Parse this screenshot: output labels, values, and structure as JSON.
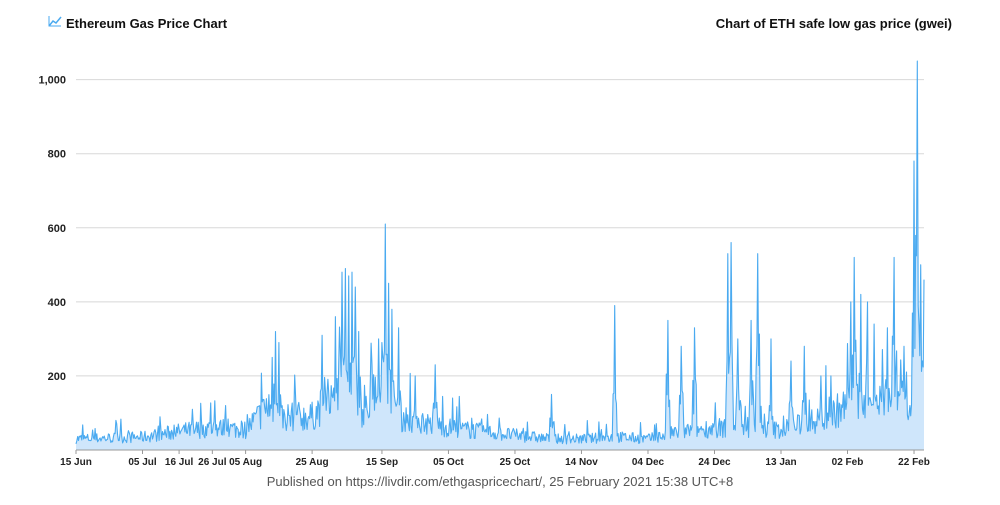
{
  "header": {
    "title": "Ethereum Gas Price Chart",
    "icon": "line-chart-icon",
    "subtitle": "Chart of ETH safe low gas price (gwei)"
  },
  "footer": {
    "text": "Published on https://livdir.com/ethgaspricechart/, 25 February 2021 15:38 UTC+8"
  },
  "colors": {
    "line": "#4aaaf0",
    "fill": "#cfe6fb",
    "grid": "#d8d8d8"
  },
  "chart_data": {
    "type": "area",
    "title": "Chart of ETH safe low gas price (gwei)",
    "xlabel": "",
    "ylabel": "",
    "x_range": [
      "2020-06-15",
      "2021-02-25"
    ],
    "ylim": [
      0,
      1080
    ],
    "y_ticks": [
      200,
      400,
      600,
      800,
      1000
    ],
    "y_tick_labels": [
      "200",
      "400",
      "600",
      "800",
      "1,000"
    ],
    "x_ticks": [
      {
        "date": "2020-06-15",
        "label": "15 Jun"
      },
      {
        "date": "2020-07-05",
        "label": "05 Jul"
      },
      {
        "date": "2020-07-16",
        "label": "16 Jul"
      },
      {
        "date": "2020-07-26",
        "label": "26 Jul"
      },
      {
        "date": "2020-08-05",
        "label": "05 Aug"
      },
      {
        "date": "2020-08-25",
        "label": "25 Aug"
      },
      {
        "date": "2020-09-15",
        "label": "15 Sep"
      },
      {
        "date": "2020-10-05",
        "label": "05 Oct"
      },
      {
        "date": "2020-10-25",
        "label": "25 Oct"
      },
      {
        "date": "2020-11-14",
        "label": "14 Nov"
      },
      {
        "date": "2020-12-04",
        "label": "04 Dec"
      },
      {
        "date": "2020-12-24",
        "label": "24 Dec"
      },
      {
        "date": "2021-01-13",
        "label": "13 Jan"
      },
      {
        "date": "2021-02-02",
        "label": "02 Feb"
      },
      {
        "date": "2021-02-22",
        "label": "22 Feb"
      }
    ],
    "grid": true,
    "series": [
      {
        "baseline": [
          [
            "2020-06-15",
            30
          ],
          [
            "2020-07-05",
            35
          ],
          [
            "2020-07-16",
            50
          ],
          [
            "2020-07-26",
            60
          ],
          [
            "2020-08-05",
            55
          ],
          [
            "2020-08-12",
            120
          ],
          [
            "2020-08-16",
            90
          ],
          [
            "2020-08-25",
            90
          ],
          [
            "2020-08-31",
            150
          ],
          [
            "2020-09-04",
            120
          ],
          [
            "2020-09-10",
            100
          ],
          [
            "2020-09-15",
            140
          ],
          [
            "2020-09-20",
            90
          ],
          [
            "2020-09-30",
            70
          ],
          [
            "2020-10-05",
            60
          ],
          [
            "2020-10-15",
            50
          ],
          [
            "2020-10-25",
            40
          ],
          [
            "2020-11-05",
            30
          ],
          [
            "2020-11-14",
            30
          ],
          [
            "2020-11-25",
            35
          ],
          [
            "2020-12-04",
            30
          ],
          [
            "2020-12-14",
            50
          ],
          [
            "2020-12-24",
            60
          ],
          [
            "2021-01-03",
            55
          ],
          [
            "2021-01-13",
            55
          ],
          [
            "2021-01-24",
            80
          ],
          [
            "2021-02-02",
            120
          ],
          [
            "2021-02-12",
            130
          ],
          [
            "2021-02-22",
            150
          ],
          [
            "2021-02-25",
            140
          ]
        ],
        "spikes": [
          [
            "2020-06-27",
            80
          ],
          [
            "2020-07-20",
            110
          ],
          [
            "2020-07-30",
            120
          ],
          [
            "2020-08-14",
            320
          ],
          [
            "2020-08-15",
            290
          ],
          [
            "2020-08-13",
            250
          ],
          [
            "2020-08-20",
            150
          ],
          [
            "2020-08-29",
            160
          ],
          [
            "2020-09-01",
            360
          ],
          [
            "2020-09-02",
            230
          ],
          [
            "2020-09-03",
            480
          ],
          [
            "2020-09-04",
            490
          ],
          [
            "2020-09-05",
            470
          ],
          [
            "2020-09-06",
            480
          ],
          [
            "2020-09-07",
            440
          ],
          [
            "2020-09-08",
            320
          ],
          [
            "2020-09-12",
            230
          ],
          [
            "2020-09-14",
            300
          ],
          [
            "2020-09-15",
            290
          ],
          [
            "2020-09-16",
            610
          ],
          [
            "2020-09-17",
            450
          ],
          [
            "2020-09-18",
            380
          ],
          [
            "2020-09-20",
            330
          ],
          [
            "2020-09-25",
            200
          ],
          [
            "2020-10-01",
            230
          ],
          [
            "2020-11-05",
            150
          ],
          [
            "2020-11-24",
            390
          ],
          [
            "2020-12-10",
            350
          ],
          [
            "2020-12-14",
            280
          ],
          [
            "2020-12-18",
            330
          ],
          [
            "2020-12-28",
            530
          ],
          [
            "2020-12-29",
            560
          ],
          [
            "2020-12-31",
            300
          ],
          [
            "2021-01-04",
            350
          ],
          [
            "2021-01-06",
            530
          ],
          [
            "2021-01-10",
            300
          ],
          [
            "2021-01-16",
            240
          ],
          [
            "2021-01-20",
            280
          ],
          [
            "2021-01-25",
            200
          ],
          [
            "2021-01-28",
            200
          ],
          [
            "2021-02-03",
            400
          ],
          [
            "2021-02-04",
            520
          ],
          [
            "2021-02-06",
            420
          ],
          [
            "2021-02-08",
            400
          ],
          [
            "2021-02-10",
            340
          ],
          [
            "2021-02-14",
            330
          ],
          [
            "2021-02-16",
            520
          ],
          [
            "2021-02-19",
            280
          ],
          [
            "2021-02-22",
            780
          ],
          [
            "2021-02-23",
            1050
          ],
          [
            "2021-02-24",
            500
          ],
          [
            "2021-02-25",
            460
          ]
        ]
      }
    ]
  }
}
